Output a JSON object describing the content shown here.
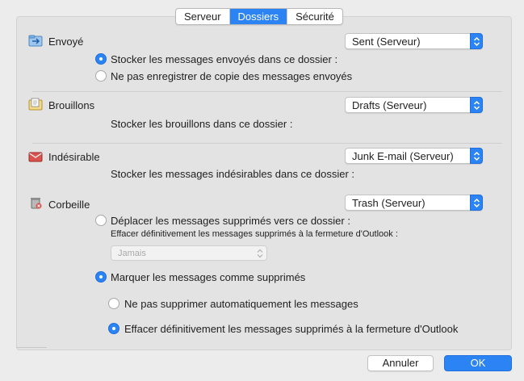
{
  "tabs": [
    "Serveur",
    "Dossiers",
    "Sécurité"
  ],
  "active_tab": "Dossiers",
  "sent": {
    "label": "Envoyé",
    "select_value": "Sent (Serveur)",
    "options": [
      {
        "label": "Stocker les messages envoyés dans ce dossier :",
        "checked": true
      },
      {
        "label": "Ne pas enregistrer de copie des messages envoyés",
        "checked": false
      }
    ]
  },
  "drafts": {
    "label": "Brouillons",
    "select_value": "Drafts (Serveur)",
    "description": "Stocker les brouillons dans ce dossier :"
  },
  "junk": {
    "label": "Indésirable",
    "select_value": "Junk E-mail (Serveur)",
    "description": "Stocker les messages indésirables dans ce dossier :"
  },
  "trash": {
    "label": "Corbeille",
    "select_value": "Trash (Serveur)",
    "move_option": {
      "label": "Déplacer les messages supprimés vers ce dossier :",
      "checked": false
    },
    "empty_sublabel": "Effacer définitivement les messages supprimés à la fermeture d'Outlook :",
    "empty_select_value": "Jamais",
    "mark_option": {
      "label": "Marquer les messages comme supprimés",
      "checked": true
    },
    "sub_options": [
      {
        "label": "Ne pas supprimer automatiquement les messages",
        "checked": false
      },
      {
        "label": "Effacer définitivement les messages supprimés à la fermeture d'Outlook",
        "checked": true
      }
    ]
  },
  "buttons": {
    "cancel": "Annuler",
    "ok": "OK"
  },
  "colors": {
    "accent": "#2c83f4",
    "background": "#ececec",
    "panel": "#e3e3e3"
  }
}
